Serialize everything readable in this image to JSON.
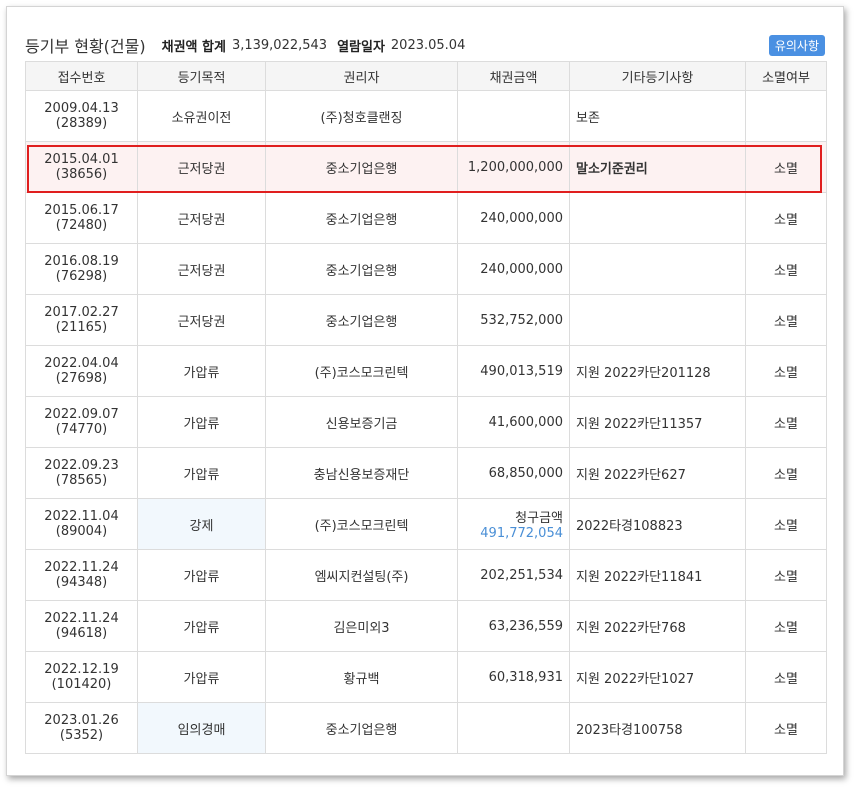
{
  "header": {
    "title": "등기부 현황(건물)",
    "sum_label": "채권액 합계",
    "sum_value": "3,139,022,543",
    "date_label": "열람일자",
    "date_value": "2023.05.04",
    "notice_button": "유의사항"
  },
  "columns": [
    "접수번호",
    "등기목적",
    "권리자",
    "채권금액",
    "기타등기사항",
    "소멸여부"
  ],
  "rows": [
    {
      "date": "2009.04.13",
      "no": "(28389)",
      "purpose": "소유권이전",
      "holder": "(주)청호클랜징",
      "amount": "",
      "etc": "보존",
      "status": ""
    },
    {
      "date": "2015.04.01",
      "no": "(38656)",
      "purpose": "근저당권",
      "holder": "중소기업은행",
      "amount": "1,200,000,000",
      "etc": "말소기준권리",
      "status": "소멸"
    },
    {
      "date": "2015.06.17",
      "no": "(72480)",
      "purpose": "근저당권",
      "holder": "중소기업은행",
      "amount": "240,000,000",
      "etc": "",
      "status": "소멸"
    },
    {
      "date": "2016.08.19",
      "no": "(76298)",
      "purpose": "근저당권",
      "holder": "중소기업은행",
      "amount": "240,000,000",
      "etc": "",
      "status": "소멸"
    },
    {
      "date": "2017.02.27",
      "no": "(21165)",
      "purpose": "근저당권",
      "holder": "중소기업은행",
      "amount": "532,752,000",
      "etc": "",
      "status": "소멸"
    },
    {
      "date": "2022.04.04",
      "no": "(27698)",
      "purpose": "가압류",
      "holder": "(주)코스모크린텍",
      "amount": "490,013,519",
      "etc": "지원 2022카단201128",
      "status": "소멸"
    },
    {
      "date": "2022.09.07",
      "no": "(74770)",
      "purpose": "가압류",
      "holder": "신용보증기금",
      "amount": "41,600,000",
      "etc": "지원 2022카단11357",
      "status": "소멸"
    },
    {
      "date": "2022.09.23",
      "no": "(78565)",
      "purpose": "가압류",
      "holder": "충남신용보증재단",
      "amount": "68,850,000",
      "etc": "지원 2022카단627",
      "status": "소멸"
    },
    {
      "date": "2022.11.04",
      "no": "(89004)",
      "purpose": "강제",
      "holder": "(주)코스모크린텍",
      "amount_label": "청구금액",
      "amount": "491,772,054",
      "etc": "2022타경108823",
      "status": "소멸"
    },
    {
      "date": "2022.11.24",
      "no": "(94348)",
      "purpose": "가압류",
      "holder": "엠씨지컨설팅(주)",
      "amount": "202,251,534",
      "etc": "지원 2022카단11841",
      "status": "소멸"
    },
    {
      "date": "2022.11.24",
      "no": "(94618)",
      "purpose": "가압류",
      "holder": "김은미외3",
      "amount": "63,236,559",
      "etc": "지원 2022카단768",
      "status": "소멸"
    },
    {
      "date": "2022.12.19",
      "no": "(101420)",
      "purpose": "가압류",
      "holder": "황규백",
      "amount": "60,318,931",
      "etc": "지원 2022카단1027",
      "status": "소멸"
    },
    {
      "date": "2023.01.26",
      "no": "(5352)",
      "purpose": "임의경매",
      "holder": "중소기업은행",
      "amount": "",
      "etc": "2023타경100758",
      "status": "소멸"
    }
  ],
  "colors": {
    "highlight_border": "#e01e1e",
    "highlight_bg": "#fdf2f2",
    "auction_bg": "#f2f8fd",
    "claim_amount": "#4a8fd6",
    "notice_button": "#4a90e2"
  }
}
